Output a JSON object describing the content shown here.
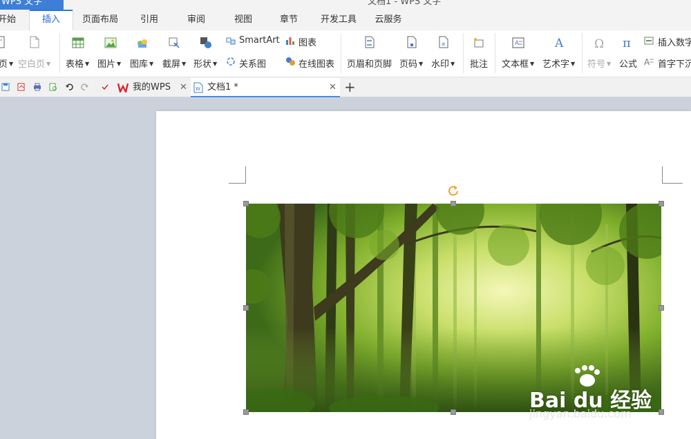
{
  "window": {
    "app_tab": "WPS 文字",
    "title": "文档1 - WPS 文字"
  },
  "menu": {
    "tabs": [
      {
        "label": "开始"
      },
      {
        "label": "插入"
      },
      {
        "label": "页面布局"
      },
      {
        "label": "引用"
      },
      {
        "label": "审阅"
      },
      {
        "label": "视图"
      },
      {
        "label": "章节"
      },
      {
        "label": "开发工具"
      },
      {
        "label": "云服务"
      }
    ],
    "active": "插入"
  },
  "ribbon": {
    "page_partial": "页",
    "blank_page": "空白页",
    "table": "表格",
    "picture": "图片",
    "gallery": "图库",
    "screenshot": "截屏",
    "shape": "形状",
    "smartart": "SmartArt",
    "relation": "关系图",
    "chart": "图表",
    "online_chart": "在线图表",
    "header_footer": "页眉和页脚",
    "page_number": "页码",
    "watermark": "水印",
    "comment": "批注",
    "textbox": "文本框",
    "wordart": "艺术字",
    "symbol": "符号",
    "formula": "公式",
    "insert_number": "插入数字",
    "drop_cap": "首字下沉"
  },
  "doc_tabs": {
    "home_tab": "我的WPS",
    "doc_tab": "文档1 *",
    "add": "+"
  },
  "image": {
    "watermark_brand": "Bai du 经验",
    "watermark_url": "jingyan.baidu.com"
  },
  "colors": {
    "accent": "#2e7ad6",
    "app_tab_bg": "#3d7fd6",
    "workspace_bg": "#ccd2dc",
    "wps_red": "#d9272e"
  }
}
